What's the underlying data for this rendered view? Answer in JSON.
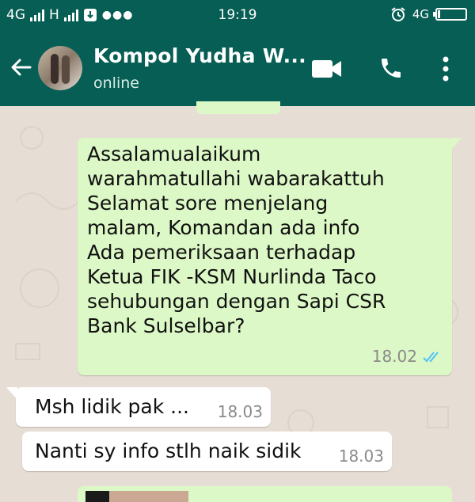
{
  "status_bar": {
    "network_left": "4G",
    "network_mid": "H",
    "time": "19:19",
    "network_right": "4G"
  },
  "header": {
    "contact_name": "Kompol Yudha W...",
    "status": "online"
  },
  "messages": [
    {
      "direction": "outgoing",
      "lines": [
        "Assalamualaikum",
        "warahmatullahi wabarakattuh",
        "Selamat sore menjelang",
        "malam, Komandan ada info",
        "Ada pemeriksaan terhadap",
        "Ketua FIK -KSM Nurlinda Taco",
        "sehubungan dengan Sapi CSR",
        "Bank Sulselbar?"
      ],
      "time": "18.02",
      "ticks": "read"
    },
    {
      "direction": "incoming",
      "text": "Msh lidik pak ...",
      "time": "18.03"
    },
    {
      "direction": "incoming",
      "text": "Nanti sy info stlh naik sidik",
      "time": "18.03"
    }
  ],
  "colors": {
    "header": "#075e54",
    "outgoing_bubble": "#dcf8c6",
    "incoming_bubble": "#ffffff",
    "read_ticks": "#4fc3f7",
    "background": "#e6ddd4"
  }
}
